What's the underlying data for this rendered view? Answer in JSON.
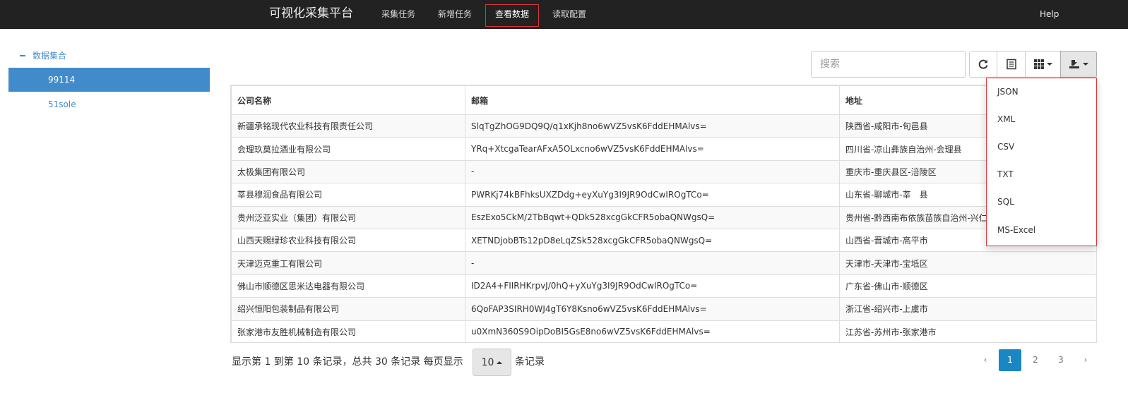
{
  "navbar": {
    "brand": "可视化采集平台",
    "items": [
      {
        "label": "采集任务"
      },
      {
        "label": "新增任务"
      },
      {
        "label": "查看数据",
        "active": true
      },
      {
        "label": "读取配置"
      }
    ],
    "help": "Help"
  },
  "sidebar": {
    "root_label": "数据集合",
    "nodes": [
      {
        "label": "99114",
        "selected": true
      },
      {
        "label": "51sole",
        "selected": false
      }
    ]
  },
  "toolbar": {
    "search_placeholder": "搜索",
    "icons": [
      "refresh-icon",
      "toggle-view-icon",
      "columns-icon",
      "export-icon"
    ]
  },
  "table": {
    "headers": [
      "公司名称",
      "邮箱",
      "地址"
    ],
    "rows": [
      [
        "新疆承铭现代农业科技有限责任公司",
        "SlqTgZhOG9DQ9Q/q1xKjh8no6wVZ5vsK6FddEHMAlvs=",
        "陕西省-咸阳市-旬邑县"
      ],
      [
        "会理玖莫拉酒业有限公司",
        "YRq+XtcgaTearAFxA5OLxcno6wVZ5vsK6FddEHMAlvs=",
        "四川省-凉山彝族自治州-会理县"
      ],
      [
        "太极集团有限公司",
        "-",
        "重庆市-重庆县区-涪陵区"
      ],
      [
        "莘县穆润食品有限公司",
        "PWRKj74kBFhksUXZDdg+eyXuYg3I9JR9OdCwIROgTCo=",
        "山东省-聊城市-莘　县"
      ],
      [
        "贵州泛亚实业（集团）有限公司",
        "EszExo5CkM/2TbBqwt+QDk528xcgGkCFR5obaQNWgsQ=",
        "贵州省-黔西南布依族苗族自治州-兴仁县"
      ],
      [
        "山西天赐绿珍农业科技有限公司",
        "XETNDjobBTs12pD8eLqZSk528xcgGkCFR5obaQNWgsQ=",
        "山西省-晋城市-高平市"
      ],
      [
        "天津迈克重工有限公司",
        "-",
        "天津市-天津市-宝坻区"
      ],
      [
        "佛山市顺德区思米达电器有限公司",
        "ID2A4+FIIRHKrpvJ/0hQ+yXuYg3I9JR9OdCwIROgTCo=",
        "广东省-佛山市-顺德区"
      ],
      [
        "绍兴恒阳包装制品有限公司",
        "6QoFAP3SIRH0WJ4gT6Y8Ksno6wVZ5vsK6FddEHMAlvs=",
        "浙江省-绍兴市-上虞市"
      ],
      [
        "张家港市友胜机械制造有限公司",
        "u0XmN360S9OipDoBI5GsE8no6wVZ5vsK6FddEHMAlvs=",
        "江苏省-苏州市-张家港市"
      ]
    ]
  },
  "footer": {
    "info": "显示第 1 到第 10 条记录，总共 30 条记录 每页显示",
    "page_size": "10",
    "suffix": "条记录",
    "pager": {
      "prev": "‹",
      "pages": [
        "1",
        "2",
        "3"
      ],
      "current": "1",
      "next": "›"
    }
  },
  "export_menu": {
    "items": [
      "JSON",
      "XML",
      "CSV",
      "TXT",
      "SQL",
      "MS-Excel"
    ]
  },
  "colors": {
    "navbar_bg": "#222222",
    "accent": "#428bca",
    "highlight_border": "#d9363e",
    "pager_active": "#1a86c4"
  }
}
